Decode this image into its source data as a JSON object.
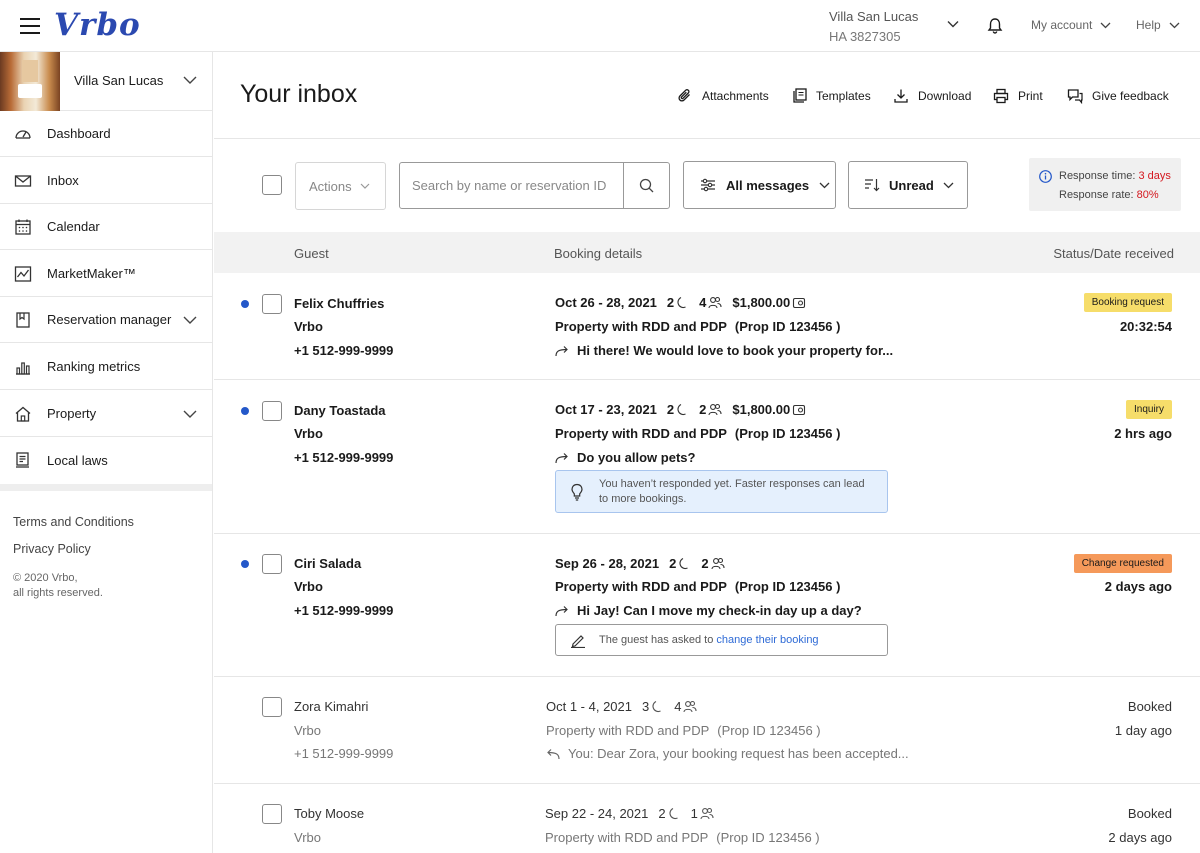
{
  "topbar": {
    "logo": "Vrbo",
    "property_name": "Villa San Lucas",
    "property_code": "HA 3827305",
    "account_label": "My account",
    "help_label": "Help"
  },
  "sidebar": {
    "property_name": "Villa San Lucas",
    "items": [
      {
        "label": "Dashboard",
        "icon": "dashboard-icon"
      },
      {
        "label": "Inbox",
        "icon": "mail-icon"
      },
      {
        "label": "Calendar",
        "icon": "calendar-icon"
      },
      {
        "label": "MarketMaker™",
        "icon": "chart-line-icon"
      },
      {
        "label": "Reservation manager",
        "icon": "book-icon"
      },
      {
        "label": "Ranking metrics",
        "icon": "bar-chart-icon"
      },
      {
        "label": "Property",
        "icon": "house-icon"
      },
      {
        "label": "Local laws",
        "icon": "laws-icon"
      }
    ],
    "terms": "Terms and Conditions",
    "privacy": "Privacy Policy",
    "copyright": "© 2020 Vrbo,",
    "rights": "all rights reserved."
  },
  "page": {
    "title": "Your inbox",
    "tools": {
      "attachments": "Attachments",
      "templates": "Templates",
      "download": "Download",
      "print": "Print",
      "feedback": "Give feedback"
    }
  },
  "filters": {
    "actions_label": "Actions",
    "search_placeholder": "Search by name or reservation ID",
    "messages_filter": "All messages",
    "sort_filter": "Unread",
    "response_time_label": "Response time:",
    "response_time_value": "3 days",
    "response_rate_label": "Response rate:",
    "response_rate_value": "80%"
  },
  "table": {
    "col_guest": "Guest",
    "col_booking": "Booking details",
    "col_status": "Status/Date received"
  },
  "rows": [
    {
      "name": "Felix Chuffries",
      "source": "Vrbo",
      "phone": "+1 512-999-9999",
      "dates": "Oct 26 - 28, 2021",
      "nights": "2",
      "guests": "4",
      "price": "$1,800.00",
      "property": "Property with RDD and PDP",
      "prop_id": "(Prop ID 123456 )",
      "message": "Hi there! We would love to book your property for...",
      "status": "Booking request",
      "time": "20:32:54"
    },
    {
      "name": "Dany Toastada",
      "source": "Vrbo",
      "phone": "+1 512-999-9999",
      "dates": "Oct 17 - 23, 2021",
      "nights": "2",
      "guests": "2",
      "price": "$1,800.00",
      "property": "Property with RDD and PDP",
      "prop_id": "(Prop ID 123456 )",
      "message": "Do you allow pets?",
      "hint_line1": "You haven’t responded yet. Faster responses can lead",
      "hint_line2": "to more bookings.",
      "status": "Inquiry",
      "time": "2 hrs ago"
    },
    {
      "name": "Ciri Salada",
      "source": "Vrbo",
      "phone": "+1 512-999-9999",
      "dates": "Sep 26 - 28, 2021",
      "nights": "2",
      "guests": "2",
      "property": "Property with RDD and PDP",
      "prop_id": "(Prop ID 123456 )",
      "message": "Hi Jay! Can I move my check-in day up a day?",
      "hint_text": "The guest has asked to ",
      "hint_link": "change their booking",
      "status": "Change requested",
      "time": "2 days ago"
    },
    {
      "name": "Zora Kimahri",
      "source": "Vrbo",
      "phone": "+1 512-999-9999",
      "dates": "Oct 1 - 4, 2021",
      "nights": "3",
      "guests": "4",
      "property": "Property with RDD and PDP",
      "prop_id": "(Prop ID 123456 )",
      "message": "You:  Dear Zora, your booking request has been accepted...",
      "status": "Booked",
      "time": "1 day ago"
    },
    {
      "name": "Toby Moose",
      "source": "Vrbo",
      "dates": "Sep 22 - 24, 2021",
      "nights": "2",
      "guests": "1",
      "property": "Property with RDD and PDP",
      "prop_id": "(Prop ID 123456 )",
      "status": "Booked",
      "time": "2 days ago"
    }
  ],
  "colors": {
    "brand": "#2b49b0",
    "unread_dot": "#2458c9",
    "badge_yellow": "#f6dd6a",
    "badge_orange": "#f5995a",
    "alert_red": "#d4181f"
  }
}
